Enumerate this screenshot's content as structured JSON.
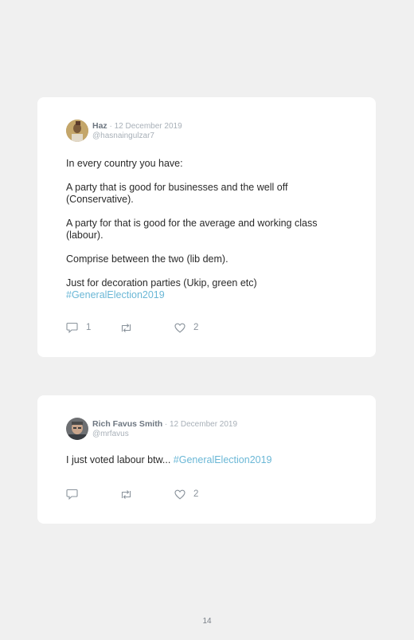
{
  "tweets": [
    {
      "name": "Haz",
      "separator": " · ",
      "date": "12 December 2019",
      "handle": "@hasnaingulzar7",
      "paragraphs": [
        "In every country you have:",
        "A party that is good for businesses and the well off (Conservative).",
        "A party for that is good for the average and working class (labour).",
        "Comprise between the two (lib dem)."
      ],
      "last_text": "Just for decoration parties (Ukip, green etc)",
      "hashtag": "#GeneralElection2019",
      "reply_count": "1",
      "retweet_count": "",
      "like_count": "2"
    },
    {
      "name": "Rich Favus Smith",
      "separator": " · ",
      "date": "12 December 2019",
      "handle": "@mrfavus",
      "text": "I just voted labour btw... ",
      "hashtag": "#GeneralElection2019",
      "reply_count": "",
      "retweet_count": "",
      "like_count": "2"
    }
  ],
  "page_number": "14",
  "icons": {
    "reply": "reply-icon",
    "retweet": "retweet-icon",
    "like": "heart-icon"
  },
  "colors": {
    "background": "#f0f0f0",
    "card": "#ffffff",
    "hashtag": "#6ab7d6",
    "muted": "#a8b0b8"
  }
}
